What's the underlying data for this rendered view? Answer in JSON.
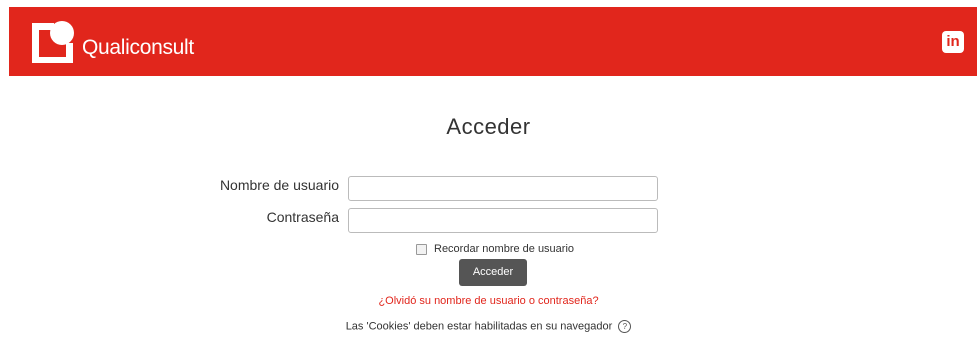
{
  "header": {
    "brand": "Qualiconsult",
    "brand_color": "#e1261c",
    "social_icon": "linkedin-icon",
    "social_label": "in"
  },
  "login": {
    "title": "Acceder",
    "username_label": "Nombre de usuario",
    "username_value": "",
    "password_label": "Contraseña",
    "password_value": "",
    "remember_label": "Recordar nombre de usuario",
    "remember_checked": false,
    "submit_label": "Acceder",
    "forgot_link": "¿Olvidó su nombre de usuario o contraseña?",
    "cookies_notice": "Las 'Cookies' deben estar habilitadas en su navegador",
    "help_icon": "help-icon",
    "help_glyph": "?"
  }
}
